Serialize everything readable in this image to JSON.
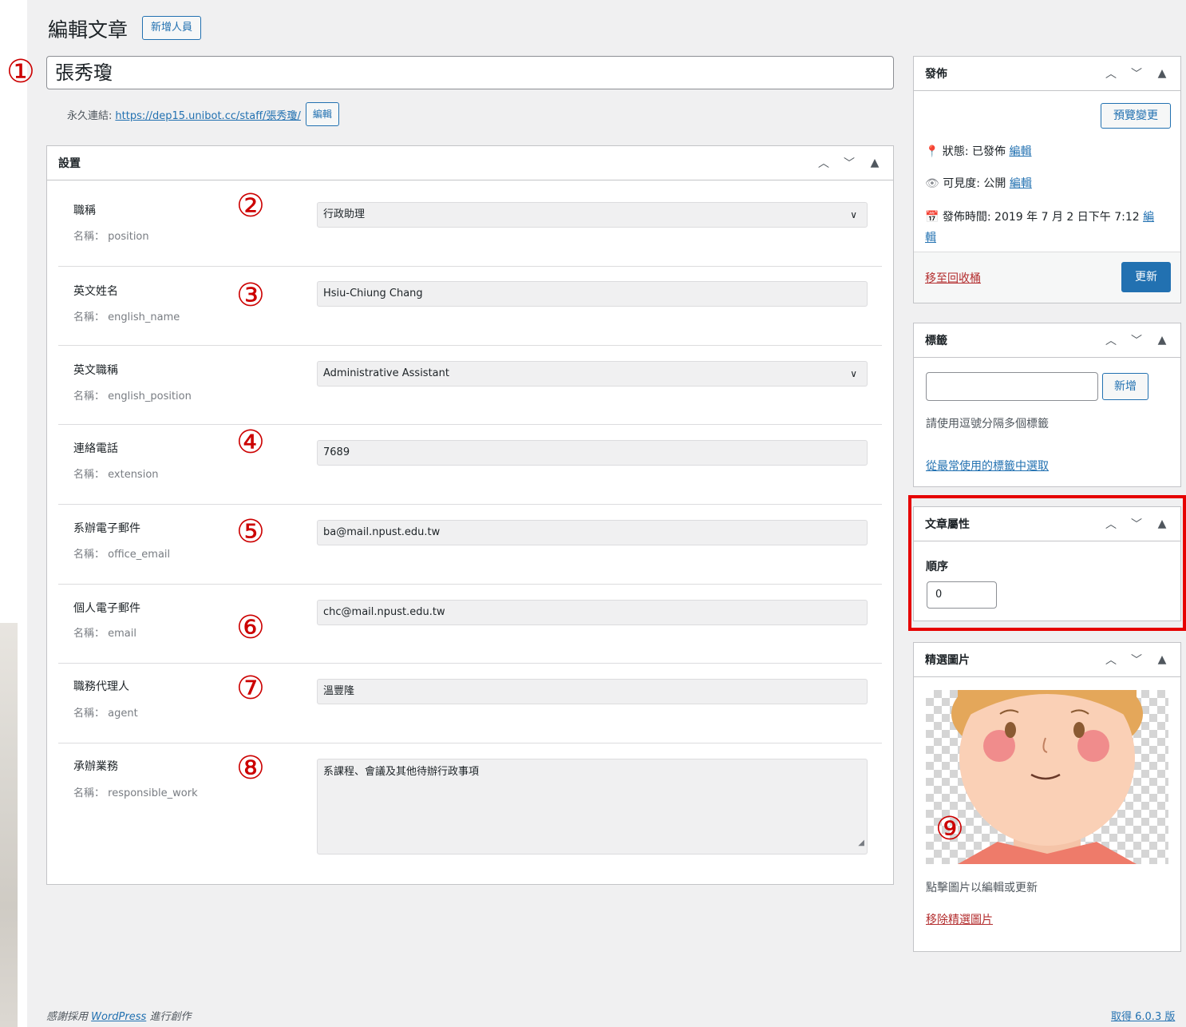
{
  "header": {
    "page_title": "編輯文章",
    "add_new_label": "新增人員"
  },
  "annotations": [
    "①",
    "②",
    "③",
    "④",
    "⑤",
    "⑥",
    "⑦",
    "⑧",
    "⑨"
  ],
  "post": {
    "title": "張秀瓊",
    "permalink_label": "永久連結:",
    "permalink_url": "https://dep15.unibot.cc/staff/張秀瓊/",
    "edit_slug_label": "編輯"
  },
  "settings_box": {
    "title": "設置",
    "fields": [
      {
        "label": "職稱",
        "meta": "名稱： position",
        "value": "行政助理",
        "type": "select"
      },
      {
        "label": "英文姓名",
        "meta": "名稱： english_name",
        "value": "Hsiu-Chiung Chang",
        "type": "text"
      },
      {
        "label": "英文職稱",
        "meta": "名稱： english_position",
        "value": "Administrative Assistant",
        "type": "select"
      },
      {
        "label": "連絡電話",
        "meta": "名稱： extension",
        "value": "7689",
        "type": "text"
      },
      {
        "label": "系辦電子郵件",
        "meta": "名稱： office_email",
        "value": "ba@mail.npust.edu.tw",
        "type": "text"
      },
      {
        "label": "個人電子郵件",
        "meta": "名稱： email",
        "value": "chc@mail.npust.edu.tw",
        "type": "text"
      },
      {
        "label": "職務代理人",
        "meta": "名稱： agent",
        "value": "溫豐隆",
        "type": "text"
      },
      {
        "label": "承辦業務",
        "meta": "名稱： responsible_work",
        "value": "系課程、會議及其他待辦行政事項",
        "type": "textarea"
      }
    ]
  },
  "publish_box": {
    "title": "發佈",
    "preview_label": "預覽變更",
    "status_label": "狀態: 已發佈",
    "visibility_label": "可見度: 公開",
    "publish_time_label": "發佈時間: 2019 年 7 月 2 日下午 7:12",
    "edit_label": "編輯",
    "edit_label_part1": "編",
    "edit_label_part2": "輯",
    "trash_label": "移至回收桶",
    "update_label": "更新"
  },
  "tags_box": {
    "title": "標籤",
    "add_label": "新增",
    "input_value": "",
    "hint": "請使用逗號分隔多個標籤",
    "choose_link": "從最常使用的標籤中選取"
  },
  "attributes_box": {
    "title": "文章屬性",
    "order_label": "順序",
    "order_value": "0"
  },
  "featured_box": {
    "title": "精選圖片",
    "hint": "點擊圖片以編輯或更新",
    "remove_link": "移除精選圖片"
  },
  "footer": {
    "credit_prefix": "感謝採用",
    "credit_link": "WordPress",
    "credit_suffix": "進行創作",
    "version_link": "取得 6.0.3 版"
  },
  "colors": {
    "accent": "#2271b1",
    "annotation_red": "#cc0000",
    "highlight_frame": "#e60000",
    "danger": "#b32d2e"
  }
}
